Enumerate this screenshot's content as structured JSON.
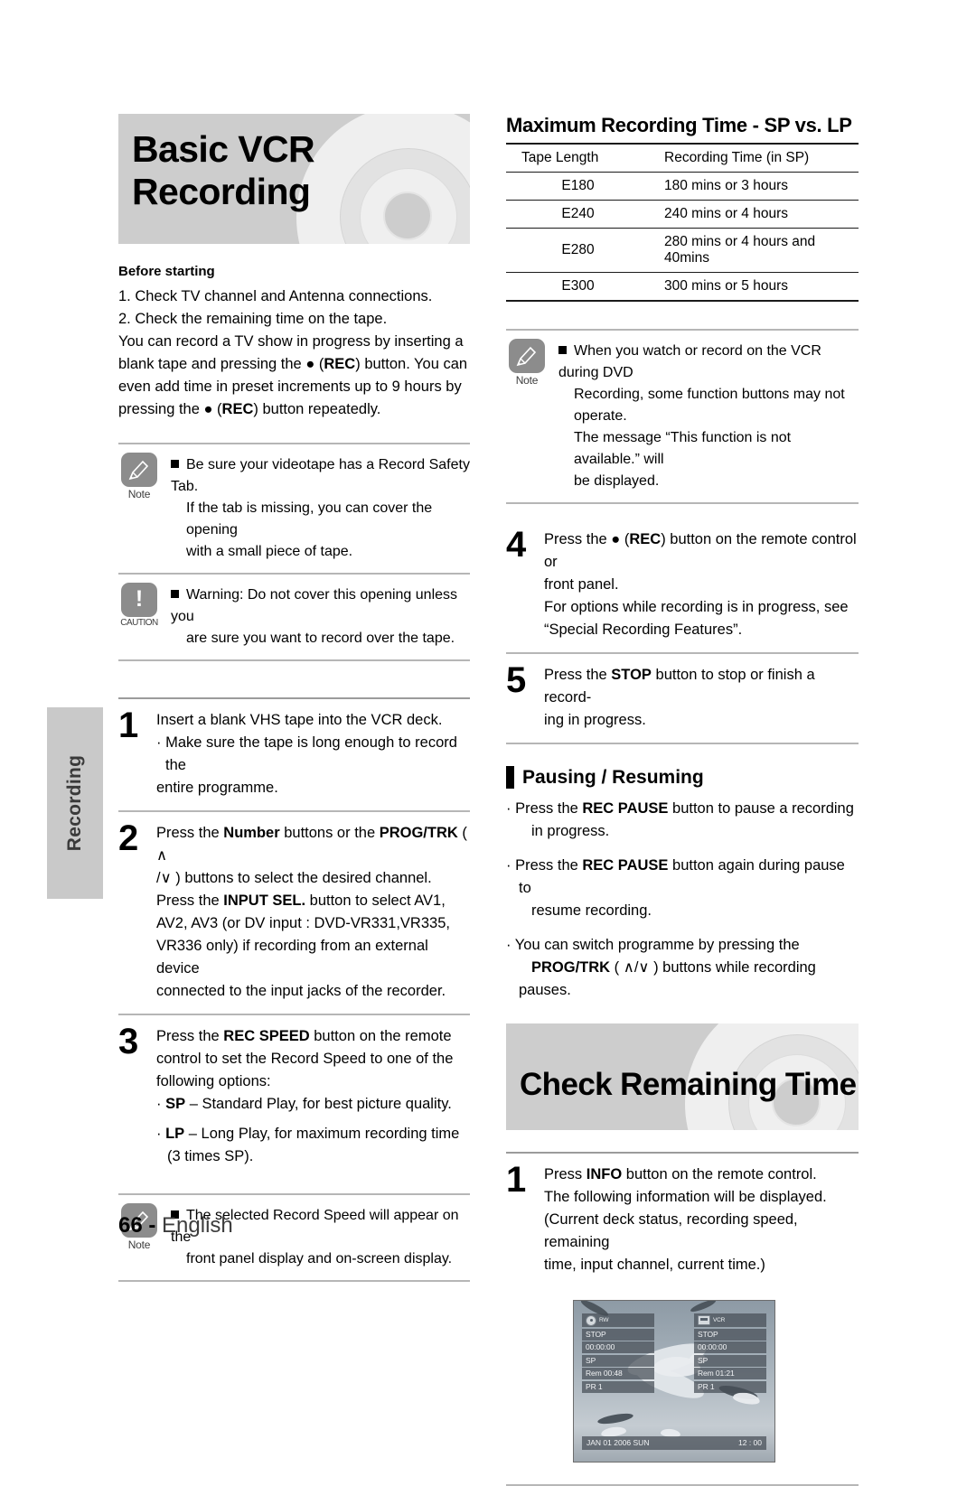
{
  "page": {
    "number": "66",
    "separator": "-",
    "language": "English",
    "side_tab_label": "Recording"
  },
  "left_column": {
    "banner_title": "Basic VCR Recording",
    "before_starting": {
      "heading": "Before starting",
      "items": [
        "1. Check TV channel and Antenna connections.",
        "2. Check the remaining time on the tape."
      ]
    },
    "intro_paragraph": {
      "line1_a": "You can record a TV show in progress by inserting a",
      "line2_a": "blank tape and pressing the ",
      "line2_rec": "REC",
      "line2_b": ") button. You can",
      "line3": "even add time in preset increments up to 9 hours by",
      "line4_a": "pressing the ",
      "line4_rec": "REC",
      "line4_b": ") button repeatedly."
    },
    "note_1": {
      "badge_caption": "Note",
      "badge_icon": "pencil-icon",
      "line1": "Be sure your videotape has a Record Safety Tab.",
      "line2": "If the tab is missing, you can cover the opening",
      "line3": "with a small piece of tape."
    },
    "caution_1": {
      "badge_caption": "CAUTION",
      "badge_icon": "exclamation-icon",
      "line1": "Warning: Do not cover this opening unless you",
      "line2": "are sure you want to record over the tape."
    },
    "steps": [
      {
        "number": "1",
        "lines": [
          "Insert a blank VHS tape into the VCR deck.",
          "· Make sure the tape is long enough to record the",
          "   entire programme."
        ]
      },
      {
        "number": "2",
        "line1_a": "Press the ",
        "line1_b": "Number",
        "line1_c": " buttons or the ",
        "line1_d": "PROG/TRK",
        "line1_e": " ( ∧",
        "line2": "/∨ ) buttons to select the desired channel.",
        "line3_a": "Press the ",
        "line3_b": "INPUT SEL.",
        "line3_c": " button to select AV1,",
        "line4": "AV2, AV3 (or DV input : DVD-VR331,VR335,",
        "line5": "VR336 only) if recording from an external device",
        "line6": "connected to the input jacks of the recorder."
      },
      {
        "number": "3",
        "line1_a": "Press the ",
        "line1_b": "REC SPEED",
        "line1_c": " button on the remote",
        "line2": "control to set the Record Speed to one of the",
        "line3": "following options:",
        "bullet1_marker": "· ",
        "bullet1_bold": "SP",
        "bullet1_rest": " – Standard Play, for best picture quality.",
        "bullet2_marker": "· ",
        "bullet2_bold": "LP",
        "bullet2_rest": " – Long Play, for maximum recording time",
        "bullet2_line2": "(3 times SP)."
      }
    ],
    "note_2": {
      "badge_caption": "Note",
      "badge_icon": "pencil-icon",
      "line1": "The selected Record Speed will appear on the",
      "line2": "front panel display and on-screen display."
    }
  },
  "right_column": {
    "table_heading": "Maximum Recording Time - SP vs. LP",
    "table": {
      "headers": [
        "Tape Length",
        "Recording Time (in SP)"
      ],
      "rows": [
        [
          "E180",
          "180 mins or 3 hours"
        ],
        [
          "E240",
          "240 mins or 4 hours"
        ],
        [
          "E280",
          "280 mins or 4 hours and 40mins"
        ],
        [
          "E300",
          "300 mins or 5 hours"
        ]
      ]
    },
    "note_3": {
      "badge_caption": "Note",
      "badge_icon": "pencil-icon",
      "line1": "When you watch or record on the VCR during DVD",
      "line2": "Recording, some function buttons may not operate.",
      "line3": "The message “This function is not available.” will",
      "line4": "be displayed."
    },
    "steps": [
      {
        "number": "4",
        "line1_a": "Press the ",
        "line1_rec": "REC",
        "line1_b": ") button on the remote control or",
        "line2": "front panel.",
        "line3": "For options while recording is in progress, see",
        "line4": "“Special Recording Features”."
      },
      {
        "number": "5",
        "line1_a": "Press the ",
        "line1_b": "STOP",
        "line1_c": " button to stop or finish a record-",
        "line2": "ing in progress."
      }
    ],
    "pausing": {
      "heading": "Pausing / Resuming",
      "bullets": [
        {
          "marker": "· ",
          "a": "Press the ",
          "bold": "REC PAUSE",
          "b": " button to pause a recording",
          "line2": "in progress."
        },
        {
          "marker": "· ",
          "a": "Press the ",
          "bold": "REC PAUSE",
          "b": " button again during pause to",
          "line2": "resume recording."
        },
        {
          "marker": "· ",
          "a": "You can switch programme by pressing the",
          "bold": "PROG/TRK",
          "b": " ( ∧/∨ ) buttons while recording pauses."
        }
      ]
    },
    "banner2_title": "Check Remaining Time",
    "step_info": {
      "number": "1",
      "line1_a": "Press ",
      "line1_b": "INFO",
      "line1_c": " button on the remote control.",
      "line2": "The following information will be displayed.",
      "line3": "(Current deck status, recording speed, remaining",
      "line4": " time, input channel, current time.)"
    },
    "osd": {
      "left_panel": {
        "icon": "dvd-rw-disc-icon",
        "icon_label": "RW",
        "status": "STOP",
        "counter": "00:00:00",
        "speed": "SP",
        "remaining": "Rem 00:48",
        "channel": "PR 1"
      },
      "right_panel": {
        "icon": "vcr-tape-icon",
        "icon_label": "VCR",
        "status": "STOP",
        "counter": "00:00:00",
        "speed": "SP",
        "remaining": "Rem 01:21",
        "channel": "PR 1"
      },
      "date": "JAN 01 2006 SUN",
      "time": "12 : 00"
    }
  },
  "colors": {
    "banner_bg": "#cdcdcd",
    "badge_gray": "#8c8c8c",
    "rule_gray": "#9f9f9f",
    "text_black": "#000000"
  }
}
